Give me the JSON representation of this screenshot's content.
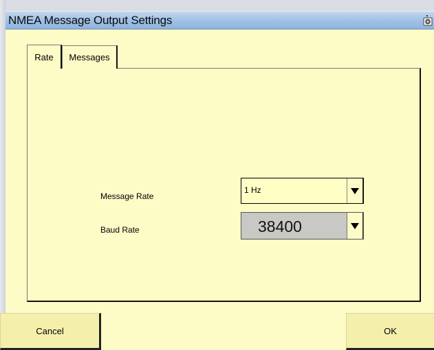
{
  "window": {
    "title": "NMEA Message Output Settings",
    "title_icon": "camera-icon"
  },
  "tabs": [
    {
      "label": "Rate",
      "active": true
    },
    {
      "label": "Messages",
      "active": false
    }
  ],
  "fields": {
    "message_rate": {
      "label": "Message Rate",
      "value": "1 Hz"
    },
    "baud_rate": {
      "label": "Baud Rate",
      "value": "38400"
    }
  },
  "buttons": {
    "cancel": "Cancel",
    "ok": "OK"
  },
  "colors": {
    "background": "#fdfbc6",
    "titlebar": "#9ec0e6",
    "baud_field": "#c8c8c4",
    "button_face": "#f4f0ac"
  }
}
